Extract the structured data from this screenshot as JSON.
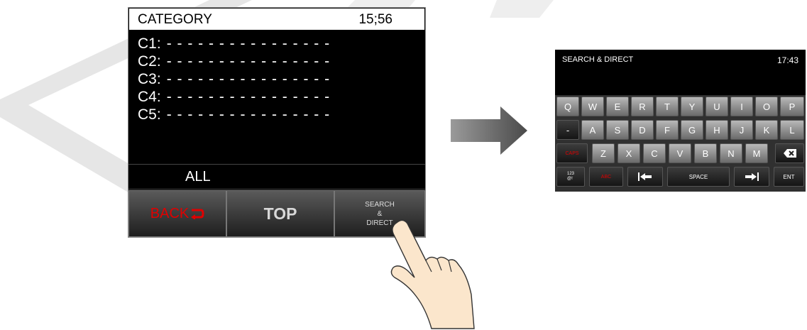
{
  "left_screen": {
    "title": "CATEGORY",
    "time": "15;56",
    "categories": [
      {
        "label": "C1:",
        "value": "- - - - - - - - - - - - - - - -"
      },
      {
        "label": "C2:",
        "value": "- - - - - - - - - - - - - - - -"
      },
      {
        "label": "C3:",
        "value": "- - - - - - - - - - - - - - - -"
      },
      {
        "label": "C4:",
        "value": "- - - - - - - - - - - - - - - -"
      },
      {
        "label": "C5:",
        "value": "- - - - - - - - - - - - - - - -"
      }
    ],
    "all_label": "ALL",
    "buttons": {
      "back": "BACK",
      "top": "TOP",
      "search_line1": "SEARCH",
      "search_line2": "&",
      "search_line3": "DIRECT"
    }
  },
  "right_screen": {
    "title": "SEARCH & DIRECT",
    "time": "17:43",
    "keyboard": {
      "row1": [
        "Q",
        "W",
        "E",
        "R",
        "T",
        "Y",
        "U",
        "I",
        "O",
        "P"
      ],
      "row2": [
        "-",
        "A",
        "S",
        "D",
        "F",
        "G",
        "H",
        "J",
        "K",
        "L"
      ],
      "row3": [
        "Z",
        "X",
        "C",
        "V",
        "B",
        "N",
        "M"
      ],
      "caps": "CAPS",
      "num_sym": "123\n@!",
      "abc": "ABC",
      "space": "SPACE",
      "ent": "ENT",
      "backspace_icon": "backspace-icon",
      "left_arrow_icon": "arrow-left-bar-icon",
      "right_arrow_icon": "arrow-right-bar-icon"
    }
  },
  "colors": {
    "screen_bg": "#000000",
    "red_text": "#e00000",
    "watermark": "#e6e6e6"
  }
}
